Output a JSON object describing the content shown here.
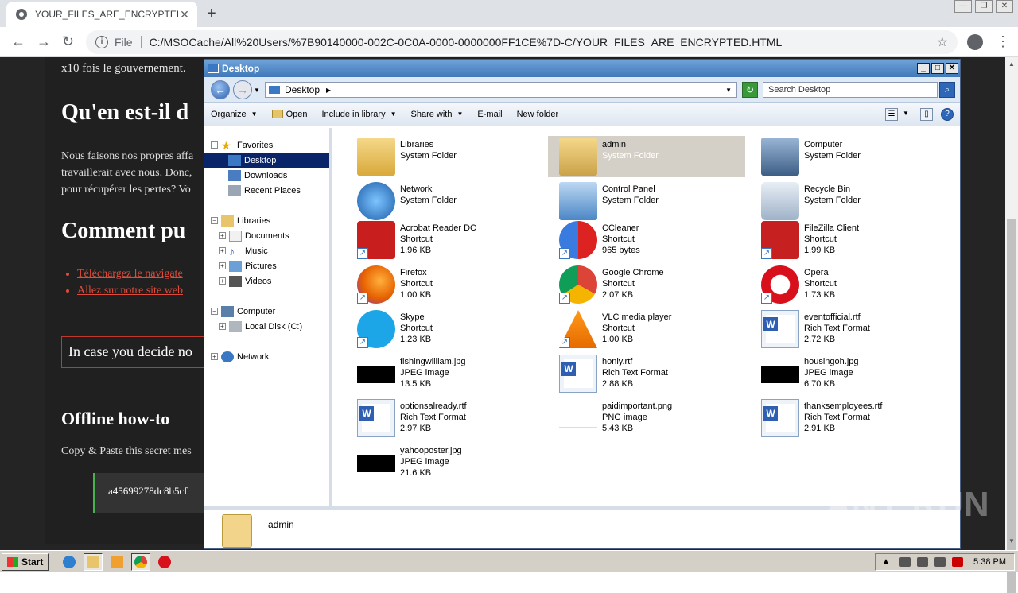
{
  "browser": {
    "tab_title": "YOUR_FILES_ARE_ENCRYPTED.HTM",
    "file_label": "File",
    "url": "C:/MSOCache/All%20Users/%7B90140000-002C-0C0A-0000-0000000FF1CE%7D-C/YOUR_FILES_ARE_ENCRYPTED.HTML"
  },
  "page": {
    "line_top": "x10 fois le gouvernement.",
    "heading1": "Qu'en est-il d",
    "para_lines": [
      "Nous faisons nos propres affa",
      "travaillerait avec nous. Donc,",
      "pour récupérer les pertes? Vo"
    ],
    "heading2": "Comment pu",
    "links": [
      "Téléchargez le navigate",
      "Allez sur notre site web"
    ],
    "boxed_text": "In case you decide no",
    "heading3": "Offline how-to",
    "copy_text": "Copy & Paste this secret mes",
    "code": "a45699278dc8b5cf"
  },
  "explorer": {
    "title": "Desktop",
    "address": "Desktop",
    "search_placeholder": "Search Desktop",
    "commands": {
      "organize": "Organize",
      "open": "Open",
      "include": "Include in library",
      "share": "Share with",
      "email": "E-mail",
      "new_folder": "New folder"
    },
    "tree": {
      "favorites": "Favorites",
      "desktop": "Desktop",
      "downloads": "Downloads",
      "recent": "Recent Places",
      "libraries": "Libraries",
      "documents": "Documents",
      "music": "Music",
      "pictures": "Pictures",
      "videos": "Videos",
      "computer": "Computer",
      "local_disk": "Local Disk (C:)",
      "network": "Network"
    },
    "items": [
      {
        "name": "Libraries",
        "type": "System Folder",
        "size": ""
      },
      {
        "name": "admin",
        "type": "System Folder",
        "size": ""
      },
      {
        "name": "Computer",
        "type": "System Folder",
        "size": ""
      },
      {
        "name": "Network",
        "type": "System Folder",
        "size": ""
      },
      {
        "name": "Control Panel",
        "type": "System Folder",
        "size": ""
      },
      {
        "name": "Recycle Bin",
        "type": "System Folder",
        "size": ""
      },
      {
        "name": "Acrobat Reader DC",
        "type": "Shortcut",
        "size": "1.96 KB"
      },
      {
        "name": "CCleaner",
        "type": "Shortcut",
        "size": "965 bytes"
      },
      {
        "name": "FileZilla Client",
        "type": "Shortcut",
        "size": "1.99 KB"
      },
      {
        "name": "Firefox",
        "type": "Shortcut",
        "size": "1.00 KB"
      },
      {
        "name": "Google Chrome",
        "type": "Shortcut",
        "size": "2.07 KB"
      },
      {
        "name": "Opera",
        "type": "Shortcut",
        "size": "1.73 KB"
      },
      {
        "name": "Skype",
        "type": "Shortcut",
        "size": "1.23 KB"
      },
      {
        "name": "VLC media player",
        "type": "Shortcut",
        "size": "1.00 KB"
      },
      {
        "name": "eventofficial.rtf",
        "type": "Rich Text Format",
        "size": "2.72 KB"
      },
      {
        "name": "fishingwilliam.jpg",
        "type": "JPEG image",
        "size": "13.5 KB"
      },
      {
        "name": "honly.rtf",
        "type": "Rich Text Format",
        "size": "2.88 KB"
      },
      {
        "name": "housingoh.jpg",
        "type": "JPEG image",
        "size": "6.70 KB"
      },
      {
        "name": "optionsalready.rtf",
        "type": "Rich Text Format",
        "size": "2.97 KB"
      },
      {
        "name": "paidimportant.png",
        "type": "PNG image",
        "size": "5.43 KB"
      },
      {
        "name": "thanksemployees.rtf",
        "type": "Rich Text Format",
        "size": "2.91 KB"
      },
      {
        "name": "yahooposter.jpg",
        "type": "JPEG image",
        "size": "21.6 KB"
      }
    ],
    "details_name": "admin"
  },
  "taskbar": {
    "start": "Start",
    "clock": "5:38 PM"
  },
  "watermark": "ANY RUN"
}
